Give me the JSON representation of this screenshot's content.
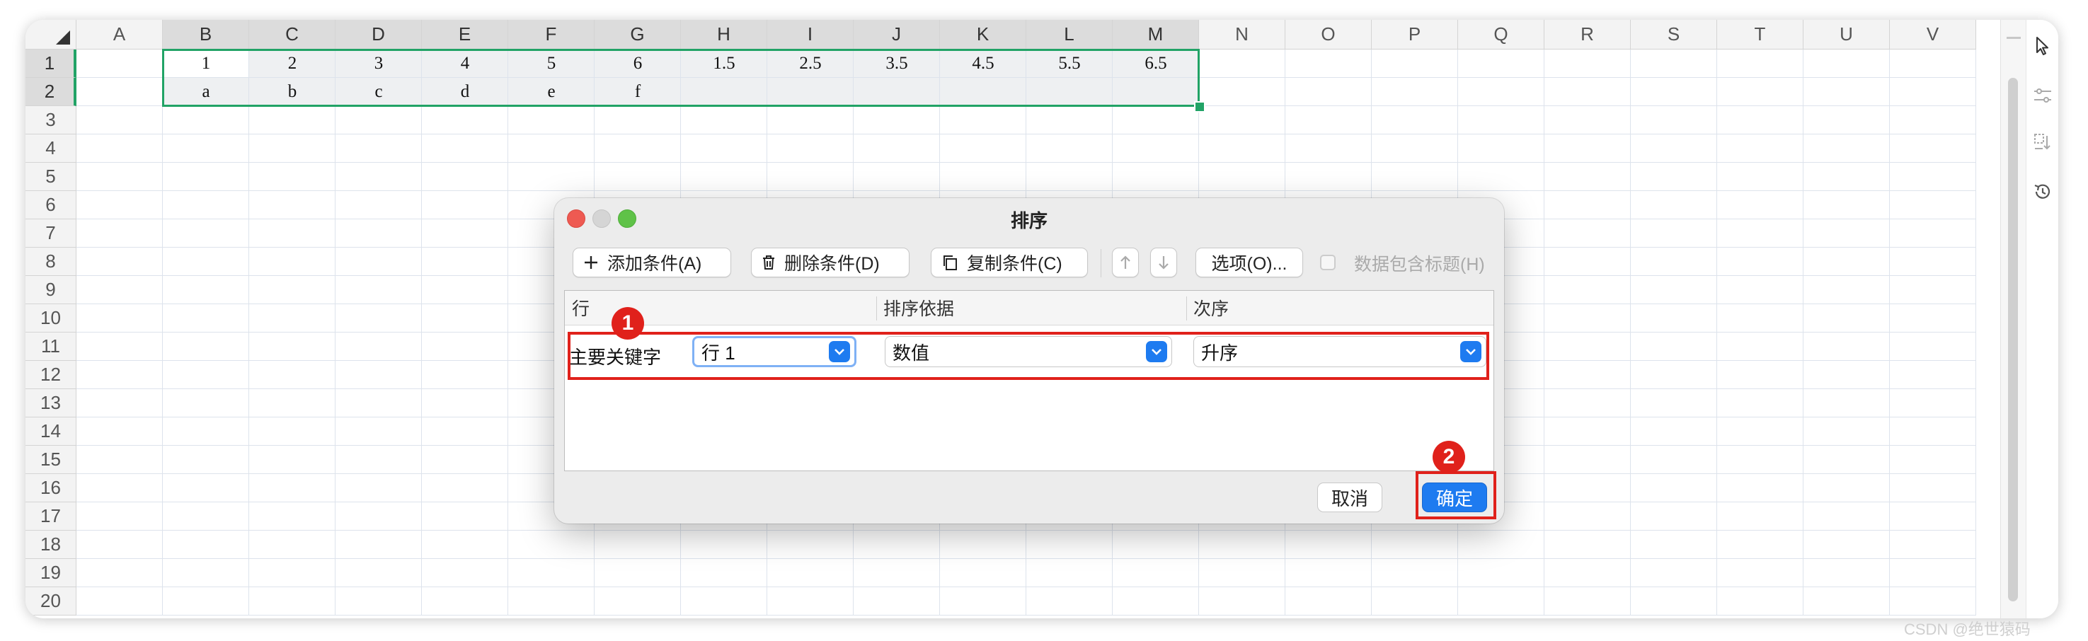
{
  "spreadsheet": {
    "columns": [
      "A",
      "B",
      "C",
      "D",
      "E",
      "F",
      "G",
      "H",
      "I",
      "J",
      "K",
      "L",
      "M",
      "N",
      "O",
      "P",
      "Q",
      "R",
      "S",
      "T",
      "U",
      "V"
    ],
    "rows": [
      "1",
      "2",
      "3",
      "4",
      "5",
      "6",
      "7",
      "8",
      "9",
      "10",
      "11",
      "12",
      "13",
      "14",
      "15",
      "16",
      "17",
      "18",
      "19",
      "20"
    ],
    "row1": [
      "",
      "1",
      "2",
      "3",
      "4",
      "5",
      "6",
      "1.5",
      "2.5",
      "3.5",
      "4.5",
      "5.5",
      "6.5"
    ],
    "row2": [
      "",
      "a",
      "b",
      "c",
      "d",
      "e",
      "f",
      "",
      "",
      "",
      "",
      "",
      ""
    ],
    "selection_color": "#21a366"
  },
  "dialog": {
    "title": "排序",
    "toolbar": {
      "add_condition": "添加条件(A)",
      "delete_condition": "删除条件(D)",
      "copy_condition": "复制条件(C)",
      "move_up_icon": "arrow-up-icon",
      "move_down_icon": "arrow-down-icon",
      "options": "选项(O)...",
      "has_header": "数据包含标题(H)"
    },
    "table_headers": {
      "row": "行",
      "sort_by": "排序依据",
      "order": "次序"
    },
    "primary_key": {
      "label": "主要关键字",
      "row_value": "行 1",
      "sort_by_value": "数值",
      "order_value": "升序"
    },
    "buttons": {
      "cancel": "取消",
      "ok": "确定"
    },
    "accent_color": "#1e7bf0"
  },
  "annotations": {
    "step1": "1",
    "step2": "2",
    "color": "#e0211b"
  },
  "watermark": "CSDN @绝世猿码"
}
